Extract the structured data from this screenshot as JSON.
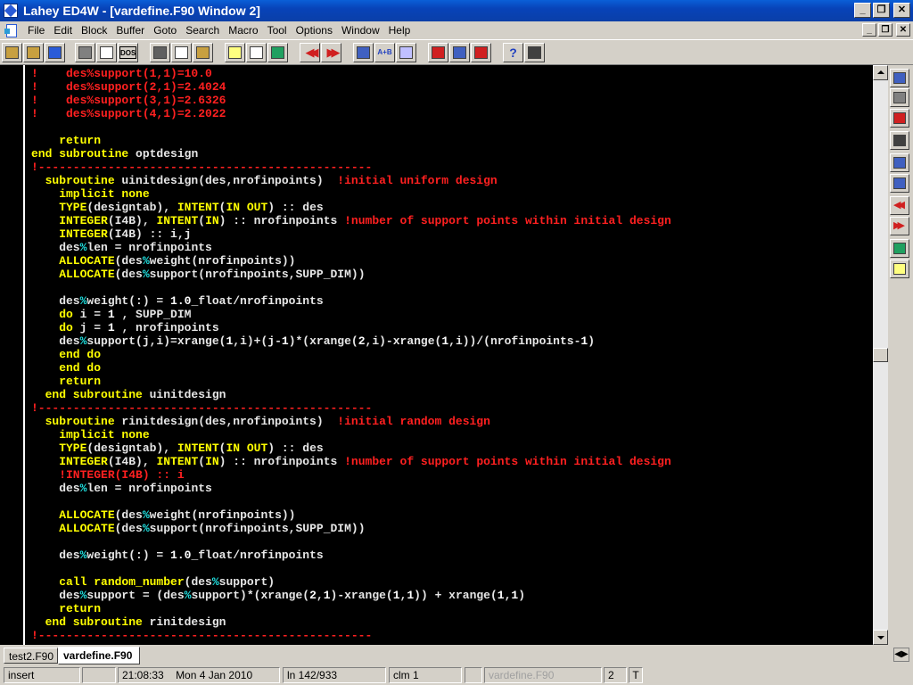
{
  "window": {
    "title": "Lahey ED4W - [vardefine.F90  Window 2]",
    "minimize_label": "_",
    "maximize_label": "❐",
    "close_label": "✕",
    "child_minimize_label": "_",
    "child_restore_label": "❐",
    "child_close_label": "✕"
  },
  "menu": [
    "File",
    "Edit",
    "Block",
    "Buffer",
    "Goto",
    "Search",
    "Macro",
    "Tool",
    "Options",
    "Window",
    "Help"
  ],
  "toolbar": {
    "icons": [
      "open-folder-icon",
      "folder-icon",
      "save-disk-icon",
      "print-icon",
      "window-icon",
      "dos-icon",
      "cut-icon",
      "copy-icon",
      "paste-icon",
      "check-icon",
      "dialog-icon",
      "globe-icon",
      "prev-icon",
      "next-icon",
      "find-icon",
      "replace-icon",
      "clear-icon",
      "tools-icon",
      "tools2-icon",
      "tools3-icon",
      "help-icon",
      "grid-icon"
    ],
    "dos_label": "DOS",
    "replace_label": "A+B"
  },
  "code_lines": [
    [
      [
        "!    des%support(1,1)=10.0",
        "c"
      ]
    ],
    [
      [
        "!    des%support(2,1)=2.4024",
        "c"
      ]
    ],
    [
      [
        "!    des%support(3,1)=2.6326",
        "c"
      ]
    ],
    [
      [
        "!    des%support(4,1)=2.2022",
        "c"
      ]
    ],
    [
      [
        "",
        ""
      ]
    ],
    [
      [
        "    return",
        "k"
      ]
    ],
    [
      [
        "end subroutine ",
        "k"
      ],
      [
        "optdesign",
        "t"
      ]
    ],
    [
      [
        "!------------------------------------------------",
        "c"
      ]
    ],
    [
      [
        "  subroutine ",
        "k"
      ],
      [
        "uinitdesign(des,nrofinpoints)  ",
        "t"
      ],
      [
        "!initial uniform design",
        "c"
      ]
    ],
    [
      [
        "    implicit none",
        "k"
      ]
    ],
    [
      [
        "    TYPE",
        "k"
      ],
      [
        "(designtab), ",
        "t"
      ],
      [
        "INTENT",
        "k"
      ],
      [
        "(",
        "t"
      ],
      [
        "IN OUT",
        "k"
      ],
      [
        ") :: des",
        "t"
      ]
    ],
    [
      [
        "    INTEGER",
        "k"
      ],
      [
        "(I4B), ",
        "t"
      ],
      [
        "INTENT",
        "k"
      ],
      [
        "(",
        "t"
      ],
      [
        "IN",
        "k"
      ],
      [
        ") :: nrofinpoints ",
        "t"
      ],
      [
        "!number of support points within initial design",
        "c"
      ]
    ],
    [
      [
        "    INTEGER",
        "k"
      ],
      [
        "(I4B) :: i,j",
        "t"
      ]
    ],
    [
      [
        "    des",
        "t"
      ],
      [
        "%",
        "s"
      ],
      [
        "len = nrofinpoints",
        "t"
      ]
    ],
    [
      [
        "    ALLOCATE",
        "k"
      ],
      [
        "(des",
        "t"
      ],
      [
        "%",
        "s"
      ],
      [
        "weight(nrofinpoints))",
        "t"
      ]
    ],
    [
      [
        "    ALLOCATE",
        "k"
      ],
      [
        "(des",
        "t"
      ],
      [
        "%",
        "s"
      ],
      [
        "support(nrofinpoints,SUPP_DIM))",
        "t"
      ]
    ],
    [
      [
        "",
        ""
      ]
    ],
    [
      [
        "    des",
        "t"
      ],
      [
        "%",
        "s"
      ],
      [
        "weight(:) = ",
        "t"
      ],
      [
        "1.0",
        "n"
      ],
      [
        "_float/nrofinpoints",
        "t"
      ]
    ],
    [
      [
        "    do ",
        "k"
      ],
      [
        "i = ",
        "t"
      ],
      [
        "1",
        "n"
      ],
      [
        " , SUPP_DIM",
        "t"
      ]
    ],
    [
      [
        "    do ",
        "k"
      ],
      [
        "j = ",
        "t"
      ],
      [
        "1",
        "n"
      ],
      [
        " , nrofinpoints",
        "t"
      ]
    ],
    [
      [
        "    des",
        "t"
      ],
      [
        "%",
        "s"
      ],
      [
        "support(j,i)=xrange(",
        "t"
      ],
      [
        "1",
        "n"
      ],
      [
        ",i)+(j-",
        "t"
      ],
      [
        "1",
        "n"
      ],
      [
        ")*(xrange(",
        "t"
      ],
      [
        "2",
        "n"
      ],
      [
        ",i)-xrange(",
        "t"
      ],
      [
        "1",
        "n"
      ],
      [
        ",i))/(nrofinpoints-",
        "t"
      ],
      [
        "1",
        "n"
      ],
      [
        ")",
        "t"
      ]
    ],
    [
      [
        "    end do",
        "k"
      ]
    ],
    [
      [
        "    end do",
        "k"
      ]
    ],
    [
      [
        "    return",
        "k"
      ]
    ],
    [
      [
        "  end subroutine ",
        "k"
      ],
      [
        "uinitdesign",
        "t"
      ]
    ],
    [
      [
        "!------------------------------------------------",
        "c"
      ]
    ],
    [
      [
        "  subroutine ",
        "k"
      ],
      [
        "rinitdesign(des,nrofinpoints)  ",
        "t"
      ],
      [
        "!initial random design",
        "c"
      ]
    ],
    [
      [
        "    implicit none",
        "k"
      ]
    ],
    [
      [
        "    TYPE",
        "k"
      ],
      [
        "(designtab), ",
        "t"
      ],
      [
        "INTENT",
        "k"
      ],
      [
        "(",
        "t"
      ],
      [
        "IN OUT",
        "k"
      ],
      [
        ") :: des",
        "t"
      ]
    ],
    [
      [
        "    INTEGER",
        "k"
      ],
      [
        "(I4B), ",
        "t"
      ],
      [
        "INTENT",
        "k"
      ],
      [
        "(",
        "t"
      ],
      [
        "IN",
        "k"
      ],
      [
        ") :: nrofinpoints ",
        "t"
      ],
      [
        "!number of support points within initial design",
        "c"
      ]
    ],
    [
      [
        "    !INTEGER(I4B) :: i",
        "c"
      ]
    ],
    [
      [
        "    des",
        "t"
      ],
      [
        "%",
        "s"
      ],
      [
        "len = nrofinpoints",
        "t"
      ]
    ],
    [
      [
        "",
        ""
      ]
    ],
    [
      [
        "    ALLOCATE",
        "k"
      ],
      [
        "(des",
        "t"
      ],
      [
        "%",
        "s"
      ],
      [
        "weight(nrofinpoints))",
        "t"
      ]
    ],
    [
      [
        "    ALLOCATE",
        "k"
      ],
      [
        "(des",
        "t"
      ],
      [
        "%",
        "s"
      ],
      [
        "support(nrofinpoints,SUPP_DIM))",
        "t"
      ]
    ],
    [
      [
        "",
        ""
      ]
    ],
    [
      [
        "    des",
        "t"
      ],
      [
        "%",
        "s"
      ],
      [
        "weight(:) = ",
        "t"
      ],
      [
        "1.0",
        "n"
      ],
      [
        "_float/nrofinpoints",
        "t"
      ]
    ],
    [
      [
        "",
        ""
      ]
    ],
    [
      [
        "    call random_number",
        "k"
      ],
      [
        "(des",
        "t"
      ],
      [
        "%",
        "s"
      ],
      [
        "support)",
        "t"
      ]
    ],
    [
      [
        "    des",
        "t"
      ],
      [
        "%",
        "s"
      ],
      [
        "support = (des",
        "t"
      ],
      [
        "%",
        "s"
      ],
      [
        "support)*(xrange(",
        "t"
      ],
      [
        "2",
        "n"
      ],
      [
        ",",
        "t"
      ],
      [
        "1",
        "n"
      ],
      [
        ")-xrange(",
        "t"
      ],
      [
        "1",
        "n"
      ],
      [
        ",",
        "t"
      ],
      [
        "1",
        "n"
      ],
      [
        ")) + xrange(",
        "t"
      ],
      [
        "1",
        "n"
      ],
      [
        ",",
        "t"
      ],
      [
        "1",
        "n"
      ],
      [
        ")",
        "t"
      ]
    ],
    [
      [
        "    return",
        "k"
      ]
    ],
    [
      [
        "  end subroutine ",
        "k"
      ],
      [
        "rinitdesign",
        "t"
      ]
    ],
    [
      [
        "!------------------------------------------------",
        "c"
      ]
    ]
  ],
  "side_icons": [
    "compile-icon",
    "wrench-icon",
    "download-icon",
    "run-icon",
    "list-icon",
    "window-icon",
    "rewind-icon",
    "fast-forward-icon",
    "image-icon",
    "bulb-icon"
  ],
  "tabs": [
    "test2.F90",
    "vardefine.F90"
  ],
  "tab_scroll_label": "◀▶",
  "status": {
    "mode": "insert",
    "time": "21:08:33",
    "date": "Mon  4 Jan 2010",
    "line_info": "ln 142/933",
    "column": "clm 1",
    "filename": "vardefine.F90",
    "window_num": "2",
    "t_label": "T"
  },
  "colors": {
    "keyword": "#ffff00",
    "text": "#e6e6e6",
    "comment": "#ff2020",
    "symbol": "#20e0e0",
    "number": "#ffffff",
    "titlebar": "#0843b8"
  }
}
